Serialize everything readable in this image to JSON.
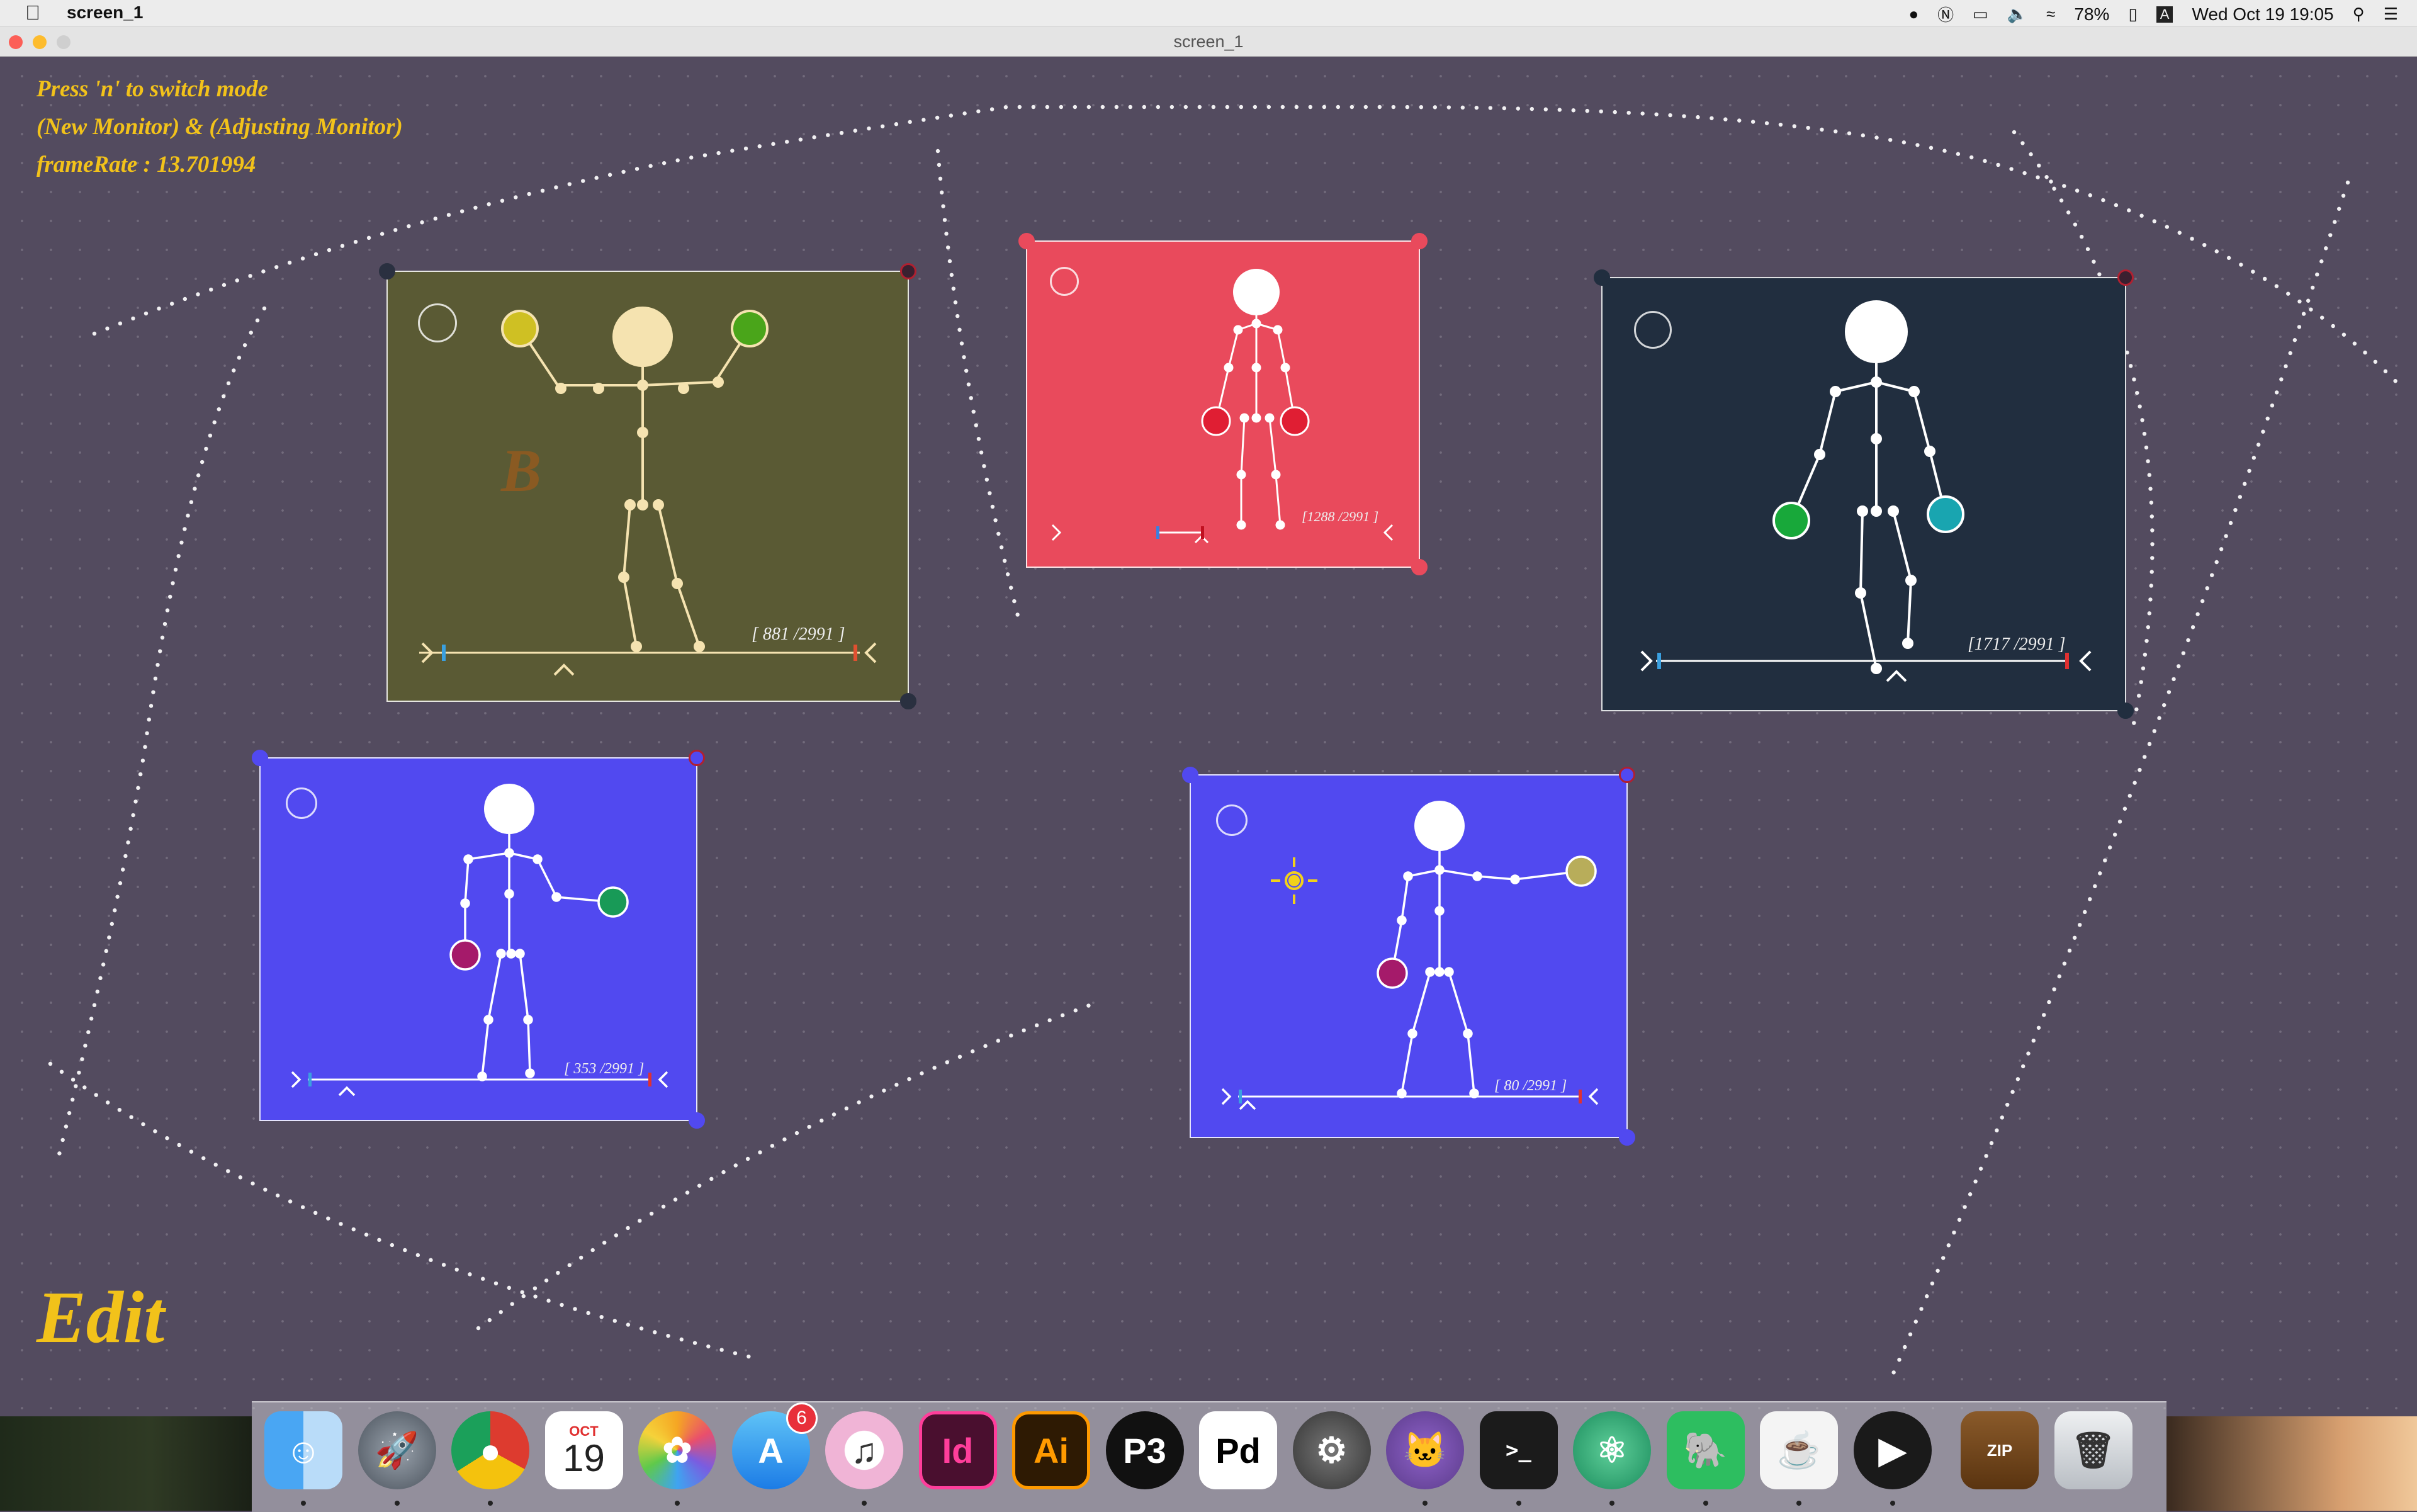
{
  "menubar": {
    "app_name": "screen_1",
    "battery": "78%",
    "input_source": "A",
    "clock": "Wed Oct 19  19:05"
  },
  "window": {
    "title": "screen_1"
  },
  "hud": {
    "line1": "Press 'n' to switch mode",
    "line2": "(New Monitor) & (Adjusting Monitor)",
    "line3": "frameRate : 13.701994"
  },
  "mode_label": "Edit",
  "monitors": [
    {
      "frame_label": "[  881 /2991 ]",
      "letter": "B",
      "background": "#5a5a34",
      "progress": 0.294
    },
    {
      "frame_label": "[1288 /2991 ]",
      "background": "#e94a5c",
      "progress": 0.431
    },
    {
      "frame_label": "[1717 /2991 ]",
      "background": "#212e3f",
      "progress": 0.574
    },
    {
      "frame_label": "[  353 /2991 ]",
      "background": "#5149f0",
      "progress": 0.118
    },
    {
      "frame_label": "[    80 /2991 ]",
      "background": "#5149f0",
      "progress": 0.027
    }
  ],
  "dock": {
    "items": [
      {
        "name": "Finder",
        "icon": "finder-icon"
      },
      {
        "name": "Launchpad",
        "icon": "rocket-icon"
      },
      {
        "name": "Chrome",
        "icon": "chrome-icon"
      },
      {
        "name": "Calendar",
        "icon": "calendar-icon",
        "month": "OCT",
        "day": "19"
      },
      {
        "name": "Photos",
        "icon": "photos-icon"
      },
      {
        "name": "App Store",
        "icon": "app-store-icon",
        "badge": "6"
      },
      {
        "name": "iTunes",
        "icon": "music-icon"
      },
      {
        "name": "InDesign",
        "icon": "indesign-icon",
        "label": "Id"
      },
      {
        "name": "Illustrator",
        "icon": "illustrator-icon",
        "label": "Ai"
      },
      {
        "name": "Processing",
        "icon": "processing-icon",
        "label": "P3"
      },
      {
        "name": "Pure Data",
        "icon": "puredata-icon",
        "label": "Pd"
      },
      {
        "name": "System Preferences",
        "icon": "gear-icon"
      },
      {
        "name": "GitHub",
        "icon": "github-icon"
      },
      {
        "name": "Terminal",
        "icon": "terminal-icon",
        "label": ">_"
      },
      {
        "name": "Atom",
        "icon": "atom-icon"
      },
      {
        "name": "Evernote",
        "icon": "evernote-icon"
      },
      {
        "name": "Java",
        "icon": "java-icon"
      },
      {
        "name": "QuickTime",
        "icon": "play-icon"
      },
      {
        "name": "Archive Utility",
        "icon": "zip-icon",
        "label": "ZIP"
      },
      {
        "name": "Trash",
        "icon": "trash-icon"
      }
    ]
  }
}
